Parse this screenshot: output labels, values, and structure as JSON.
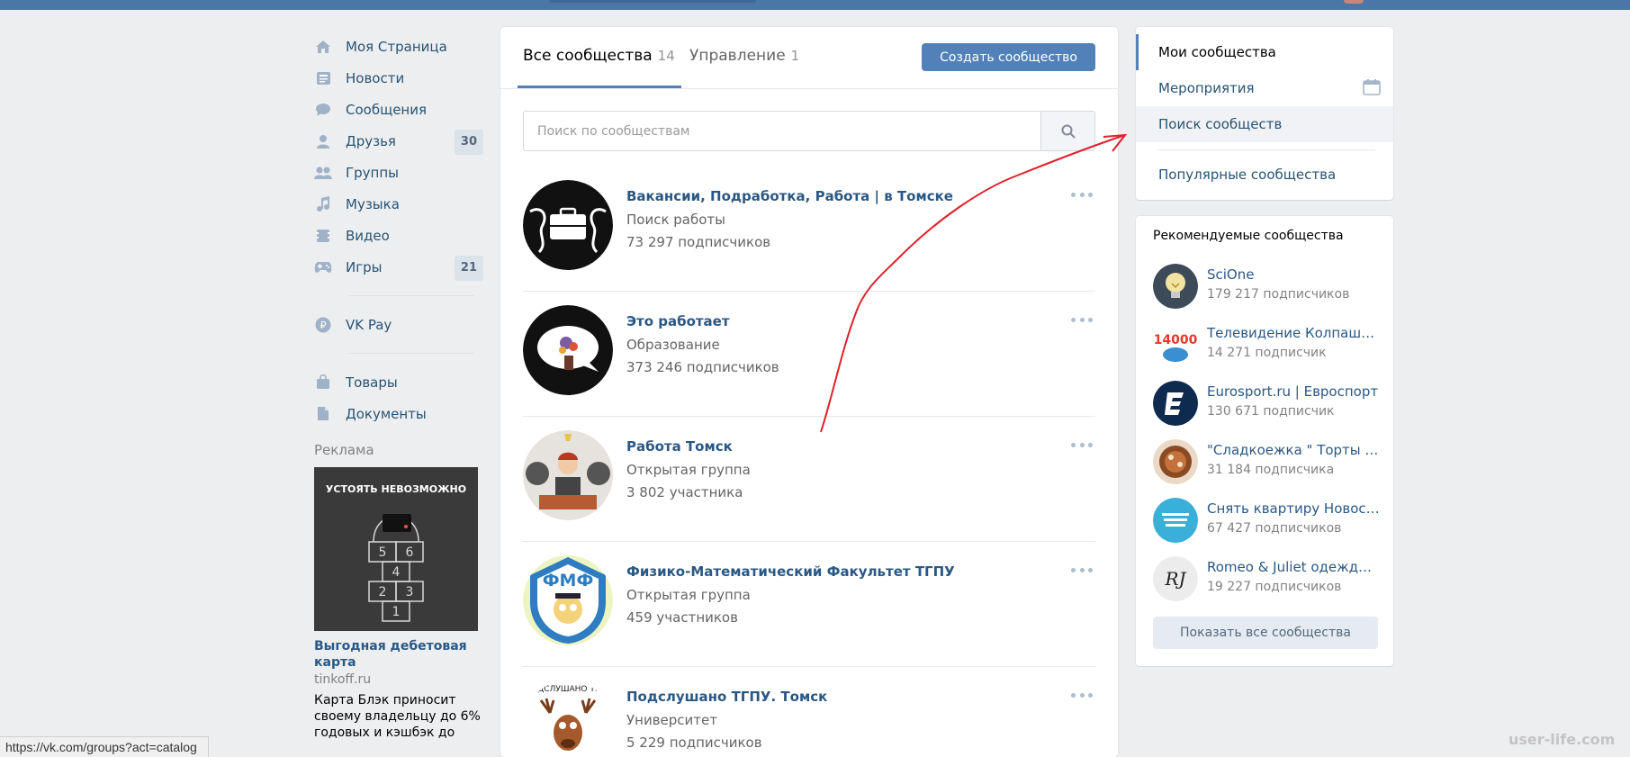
{
  "left_nav": {
    "items": [
      {
        "label": "Моя Страница",
        "icon": "home-icon",
        "count": ""
      },
      {
        "label": "Новости",
        "icon": "news-icon",
        "count": ""
      },
      {
        "label": "Сообщения",
        "icon": "messages-icon",
        "count": ""
      },
      {
        "label": "Друзья",
        "icon": "friends-icon",
        "count": "30"
      },
      {
        "label": "Группы",
        "icon": "groups-icon",
        "count": ""
      },
      {
        "label": "Музыка",
        "icon": "music-icon",
        "count": ""
      },
      {
        "label": "Видео",
        "icon": "video-icon",
        "count": ""
      },
      {
        "label": "Игры",
        "icon": "games-icon",
        "count": "21"
      }
    ],
    "vkpay": {
      "label": "VK Pay",
      "icon": "vkpay-icon"
    },
    "extra": [
      {
        "label": "Товары",
        "icon": "goods-icon"
      },
      {
        "label": "Документы",
        "icon": "documents-icon"
      }
    ]
  },
  "ads": {
    "title": "Реклама",
    "image_text": "УСТОЯТЬ НЕВОЗМОЖНО",
    "link": "Выгодная дебетовая карта",
    "domain": "tinkoff.ru",
    "text": "Карта Блэк приносит своему владельцу до 6% годовых и кэшбэк до"
  },
  "center": {
    "tabs": [
      {
        "label": "Все сообщества",
        "count": "14"
      },
      {
        "label": "Управление",
        "count": "1"
      }
    ],
    "create_button": "Создать сообщество",
    "search_placeholder": "Поиск по сообществам",
    "groups": [
      {
        "name": "Вакансии, Подработка, Работа | в Томске",
        "type": "Поиск работы",
        "subs": "73 297 подписчиков"
      },
      {
        "name": "Это работает",
        "type": "Образование",
        "subs": "373 246 подписчиков"
      },
      {
        "name": "Работа Томск",
        "type": "Открытая группа",
        "subs": "3 802 участника"
      },
      {
        "name": "Физико-Математический Факультет ТГПУ",
        "type": "Открытая группа",
        "subs": "459 участников"
      },
      {
        "name": "Подслушано ТГПУ. Томск",
        "type": "Университет",
        "subs": "5 229 подписчиков"
      }
    ],
    "avatar_texts": {
      "fmf": "ФМФ",
      "podsl": "ПОДСЛУШАНО ТГПУ"
    }
  },
  "right_menu": {
    "items": [
      {
        "label": "Мои сообщества"
      },
      {
        "label": "Мероприятия"
      },
      {
        "label": "Поиск сообществ"
      },
      {
        "label": "Популярные сообщества"
      }
    ]
  },
  "recommended": {
    "title": "Рекомендуемые сообщества",
    "items": [
      {
        "name": "SciOne",
        "subs": "179 217 подписчиков"
      },
      {
        "name": "Телевидение Колпашева",
        "subs": "14 271 подписчик"
      },
      {
        "name": "Eurosport.ru | Евроспорт",
        "subs": "130 671 подписчик"
      },
      {
        "name": "\"Сладкоежка \" Торты в Томске",
        "subs": "31 184 подписчика"
      },
      {
        "name": "Снять квартиру Новосибирск",
        "subs": "67 427 подписчиков"
      },
      {
        "name": "Romeo & Juliet одежда в Томске",
        "subs": "19 227 подписчиков"
      }
    ],
    "avatar_texts": {
      "tv": "14000",
      "rj": "RJ"
    },
    "show_all": "Показать все сообщества"
  },
  "status_url": "https://vk.com/groups?act=catalog",
  "watermark": "user-life.com",
  "colors": {
    "accent": "#5181b8",
    "header": "#4a76a8",
    "link": "#2a5885",
    "arrow": "#e0202a"
  }
}
